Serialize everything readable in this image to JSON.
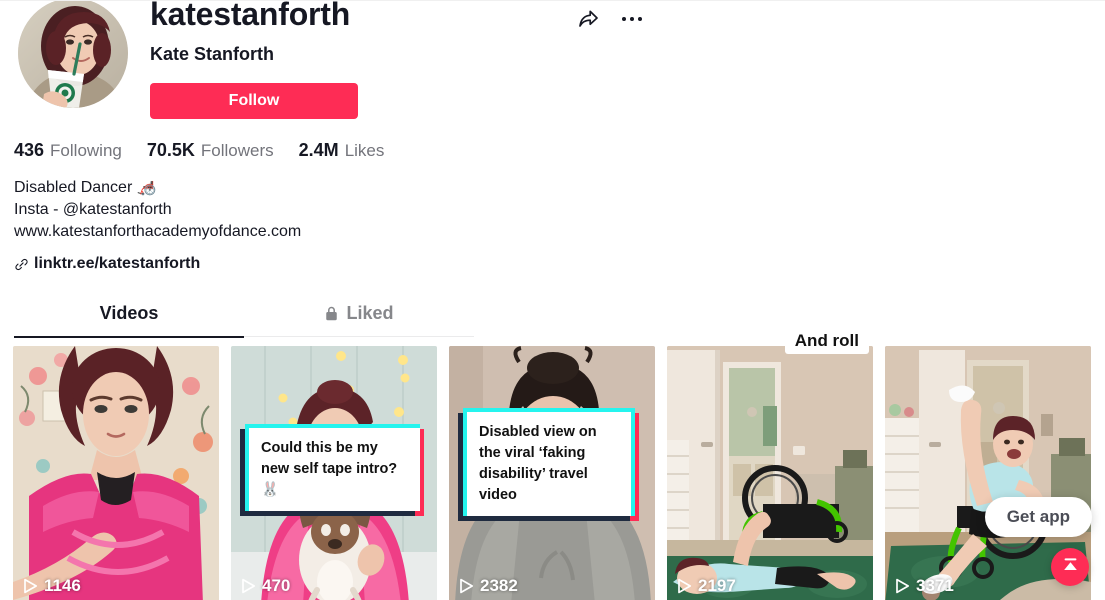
{
  "profile": {
    "username": "katestanforth",
    "display_name": "Kate Stanforth",
    "follow_label": "Follow",
    "avatar_alt": "avatar",
    "share_icon": "share-arrow-icon",
    "more_icon": "more-options-icon"
  },
  "stats": [
    {
      "value": "436",
      "label": "Following"
    },
    {
      "value": "70.5K",
      "label": "Followers"
    },
    {
      "value": "2.4M",
      "label": "Likes"
    }
  ],
  "bio": {
    "lines": [
      "Disabled Dancer 🦽",
      "Insta - @katestanforth",
      "www.katestanforthacademyofdance.com"
    ],
    "link": "linktr.ee/katestanforth",
    "link_icon": "link-icon"
  },
  "tabs": [
    {
      "label": "Videos",
      "active": true,
      "icon": null
    },
    {
      "label": "Liked",
      "active": false,
      "icon": "lock-icon"
    }
  ],
  "videos": [
    {
      "views": "1146",
      "caption": null,
      "pill": null
    },
    {
      "views": "470",
      "caption": "Could this be my new self tape intro? 🐰",
      "pill": null
    },
    {
      "views": "2382",
      "caption": "Disabled view on the viral ‘faking disability’ travel video",
      "pill": null
    },
    {
      "views": "2197",
      "caption": null,
      "pill": "And roll"
    },
    {
      "views": "3371",
      "caption": null,
      "pill": null
    }
  ],
  "floating": {
    "get_app_label": "Get app",
    "to_top_icon": "scroll-to-top-icon"
  },
  "colors": {
    "accent_red": "#FE2C55",
    "accent_cyan": "#25F4EE",
    "text_primary": "#161823",
    "text_secondary": "#73747B"
  }
}
